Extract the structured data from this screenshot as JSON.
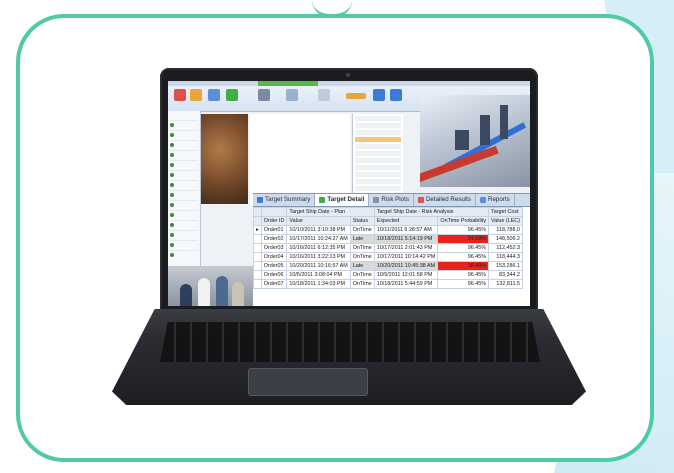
{
  "grid": {
    "tabs": [
      {
        "label": "Target Summary",
        "color": "#3a7bd5"
      },
      {
        "label": "Target Detail",
        "color": "#3fae49",
        "active": true
      },
      {
        "label": "Risk Plots",
        "color": "#8a8fa0"
      },
      {
        "label": "Detailed Results",
        "color": "#d9534f"
      },
      {
        "label": "Reports",
        "color": "#5b8fd6"
      }
    ],
    "group_headers": [
      "Target Ship Date - Plan",
      "Target Ship Date - Risk Analysis",
      "Target Cost"
    ],
    "columns": [
      "Order ID",
      "Value",
      "Status",
      "Expected",
      "OnTime Probability",
      "Value (LEC)"
    ],
    "rows": [
      [
        "Order01",
        "10/10/2011 3:10:38 PM",
        "OnTime",
        "10/11/2011 6:28:57 AM",
        "96.45%",
        "118,788.0"
      ],
      [
        "Order02",
        "10/17/2011 10:24:27 AM",
        "Late",
        "10/18/2011 5:14:19 PM",
        "24.68%",
        "148,506.2"
      ],
      [
        "Order03",
        "10/16/2011 6:12:35 PM",
        "OnTime",
        "10/17/2011 2:01:43 PM",
        "96.45%",
        "112,452.3"
      ],
      [
        "Order04",
        "10/16/2011 3:22:13 PM",
        "OnTime",
        "10/17/2011 10:14:42 PM",
        "96.45%",
        "118,444.3"
      ],
      [
        "Order05",
        "10/20/2011 10:16:57 AM",
        "Late",
        "10/20/2011 10:45:38 AM",
        "18.45%",
        "153,286.1"
      ],
      [
        "Order06",
        "10/5/2011 3:08:04 PM",
        "OnTime",
        "10/5/2011 12:01:58 PM",
        "96.45%",
        "83,344.2"
      ],
      [
        "Order07",
        "10/18/2011 1:34:03 PM",
        "OnTime",
        "10/18/2011 5:44:59 PM",
        "96.45%",
        "132,811.5"
      ]
    ],
    "late_rows": [
      1,
      4
    ],
    "selected_row": 0
  },
  "colors": {
    "frame": "#4fc9a6",
    "late": "#e8231c"
  }
}
